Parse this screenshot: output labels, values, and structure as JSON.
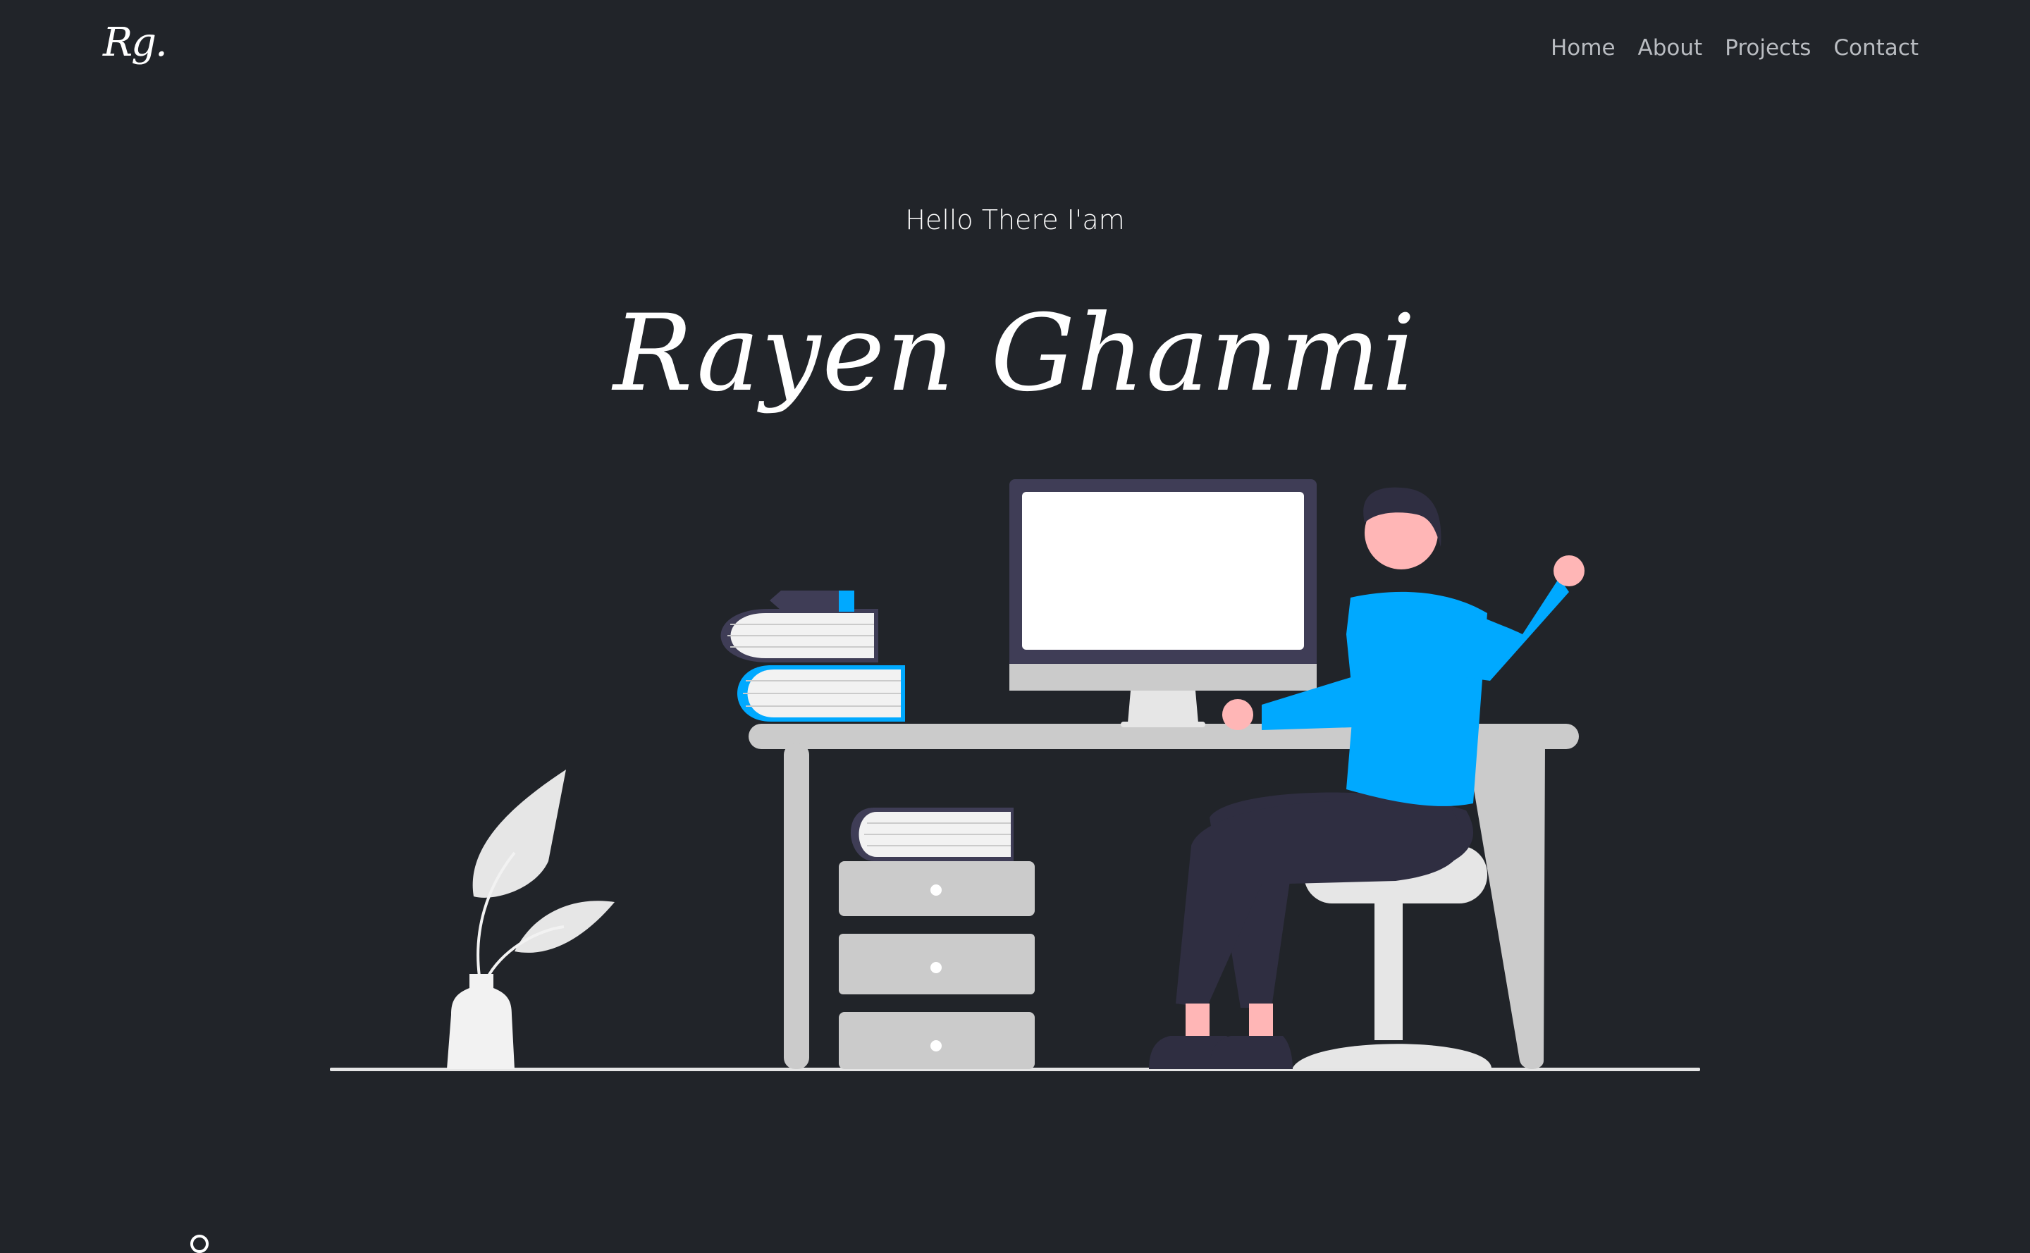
{
  "nav": {
    "logo": "Rg.",
    "links": [
      "Home",
      "About",
      "Projects",
      "Contact"
    ]
  },
  "hero": {
    "greeting": "Hello There I'am",
    "name": "Rayen Ghanmi"
  },
  "colors": {
    "background": "#212429",
    "accent": "#00a9ff",
    "desk": "#cbcbcb",
    "dark_navy": "#2f2e41",
    "skin": "#ffb6b6",
    "monitor_frame": "#3f3d56"
  },
  "illustration": {
    "icons": [
      "plant-icon",
      "books-icon",
      "monitor-icon",
      "desk-icon",
      "drawer-icon",
      "person-icon",
      "chair-icon"
    ]
  }
}
